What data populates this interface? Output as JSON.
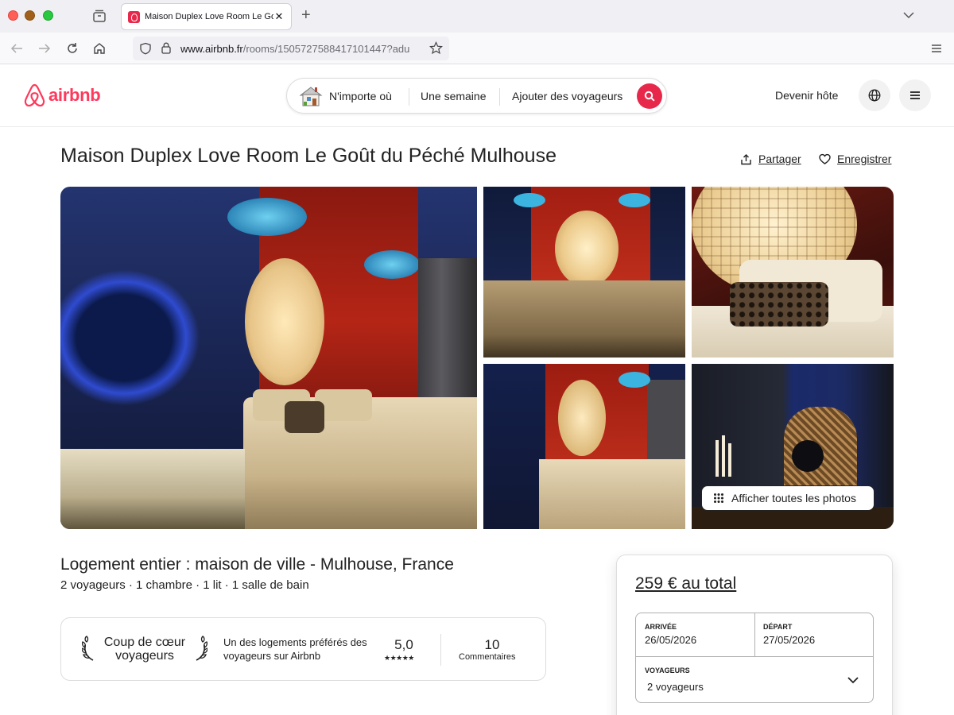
{
  "browser": {
    "tab_title": "Maison Duplex Love Room Le Goût du Péché Mulhouse",
    "tab_close": "✕",
    "new_tab": "+",
    "url_host": "www.airbnb.fr",
    "url_path": "/rooms/1505727588417101447?adu"
  },
  "header": {
    "logo_text": "airbnb",
    "search": {
      "where": "N'importe où",
      "when": "Une semaine",
      "who": "Ajouter des voyageurs"
    },
    "host_link": "Devenir hôte"
  },
  "listing": {
    "title": "Maison Duplex Love Room Le Goût du Péché Mulhouse",
    "share_label": "Partager",
    "save_label": "Enregistrer",
    "show_all_photos": "Afficher toutes les photos",
    "type": "Logement entier : maison de ville - Mulhouse, France",
    "details": "2 voyageurs · 1 chambre · 1 lit · 1 salle de bain"
  },
  "guest_favorite": {
    "title": "Coup de cœur voyageurs",
    "description": "Un des logements préférés des voyageurs sur Airbnb",
    "rating": "5,0",
    "stars": "★★★★★",
    "review_count": "10",
    "review_label": "Commentaires"
  },
  "booking": {
    "total": "259 € au total",
    "checkin_label": "ARRIVÉE",
    "checkin_value": "26/05/2026",
    "checkout_label": "DÉPART",
    "checkout_value": "27/05/2026",
    "guests_label": "VOYAGEURS",
    "guests_value": "2 voyageurs"
  },
  "colors": {
    "brand": "#ff385c",
    "search_button": "#e8284a",
    "text": "#222222",
    "border": "#dddddd"
  },
  "icons": [
    "airbnb-logo-icon",
    "search-icon",
    "globe-icon",
    "menu-icon",
    "share-icon",
    "heart-icon",
    "grid-icon",
    "laurel-icon",
    "chevron-down-icon"
  ]
}
